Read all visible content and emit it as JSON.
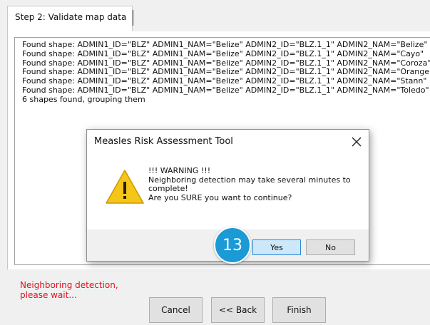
{
  "tab": {
    "label": "Step 2: Validate map data"
  },
  "log": {
    "lines": [
      "Found shape: ADMIN1_ID=\"BLZ\" ADMIN1_NAM=\"Belize\" ADMIN2_ID=\"BLZ.1_1\" ADMIN2_NAM=\"Belize\"",
      "Found shape: ADMIN1_ID=\"BLZ\" ADMIN1_NAM=\"Belize\" ADMIN2_ID=\"BLZ.1_1\" ADMIN2_NAM=\"Cayo\"",
      "Found shape: ADMIN1_ID=\"BLZ\" ADMIN1_NAM=\"Belize\" ADMIN2_ID=\"BLZ.1_1\" ADMIN2_NAM=\"Coroza\"",
      "Found shape: ADMIN1_ID=\"BLZ\" ADMIN1_NAM=\"Belize\" ADMIN2_ID=\"BLZ.1_1\" ADMIN2_NAM=\"Orange\"",
      "Found shape: ADMIN1_ID=\"BLZ\" ADMIN1_NAM=\"Belize\" ADMIN2_ID=\"BLZ.1_1\" ADMIN2_NAM=\"Stann\"",
      "Found shape: ADMIN1_ID=\"BLZ\" ADMIN1_NAM=\"Belize\" ADMIN2_ID=\"BLZ.1_1\" ADMIN2_NAM=\"Toledo\"",
      "6 shapes found, grouping them"
    ]
  },
  "dialog": {
    "title": "Measles Risk Assessment Tool",
    "close_glyph": "✕",
    "icon": "warning-icon",
    "warning_color": "#f5c518",
    "message_lines": [
      "!!! WARNING !!!",
      "Neighboring detection may take several minutes to",
      "complete!",
      "Are you SURE you want to continue?"
    ],
    "yes_label": "Yes",
    "no_label": "No"
  },
  "step_badge": {
    "number": "13",
    "color": "#1c9ad6"
  },
  "status": {
    "lines": [
      "Neighboring detection,",
      "please wait..."
    ],
    "color": "#e0121b"
  },
  "footer": {
    "cancel_label": "Cancel",
    "back_label": "<< Back",
    "finish_label": "Finish"
  }
}
